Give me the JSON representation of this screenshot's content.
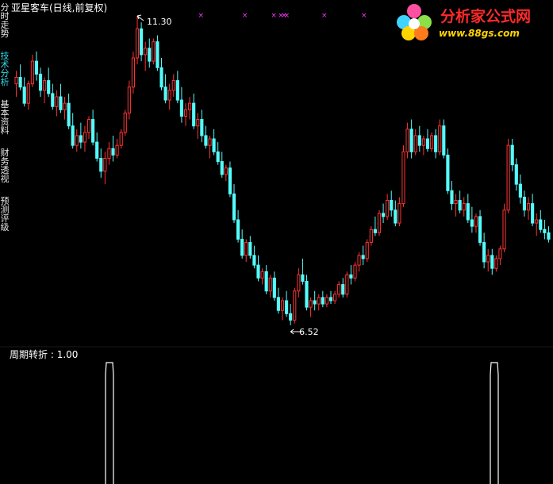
{
  "window": {
    "title": "亚星客车(日线,前复权)",
    "side_tabs": [
      {
        "label": "分时走势",
        "active": false
      },
      {
        "label": "技术分析",
        "active": true
      },
      {
        "label": "基本资料",
        "active": false
      },
      {
        "label": "财务透视",
        "active": false
      },
      {
        "label": "预测评级",
        "active": false
      }
    ]
  },
  "logo": {
    "text": "分析家公式网",
    "url": "www.88gs.com"
  },
  "colors": {
    "up": "#ff3232",
    "down": "#54fcfc",
    "marker": "#ff33ff",
    "indicator": "#ffffff",
    "text": "#ffffff",
    "active_tab": "#33d8e6"
  },
  "chart_data": [
    {
      "type": "candlestick",
      "title": "亚星客车(日线,前复权)",
      "annotations": [
        {
          "label": "11.30",
          "kind": "high"
        },
        {
          "label": "6.52",
          "kind": "low"
        }
      ],
      "ylim": [
        6.52,
        11.3
      ],
      "marker_symbol": "×",
      "marker_count": 8,
      "candles": [
        [
          10.25,
          10.45,
          10.05,
          10.35
        ],
        [
          10.35,
          10.55,
          10.15,
          10.2
        ],
        [
          10.2,
          10.35,
          9.9,
          9.95
        ],
        [
          9.95,
          10.3,
          9.85,
          10.25
        ],
        [
          10.25,
          10.7,
          10.2,
          10.6
        ],
        [
          10.6,
          10.75,
          10.3,
          10.4
        ],
        [
          10.4,
          10.5,
          10.05,
          10.15
        ],
        [
          10.15,
          10.35,
          9.95,
          10.3
        ],
        [
          10.3,
          10.5,
          10.05,
          10.1
        ],
        [
          10.1,
          10.25,
          9.85,
          9.9
        ],
        [
          9.9,
          10.15,
          9.75,
          10.05
        ],
        [
          10.05,
          10.25,
          9.8,
          9.85
        ],
        [
          9.85,
          10.05,
          9.7,
          9.95
        ],
        [
          9.95,
          10.1,
          9.55,
          9.6
        ],
        [
          9.6,
          9.8,
          9.25,
          9.3
        ],
        [
          9.3,
          9.55,
          9.2,
          9.45
        ],
        [
          9.45,
          9.65,
          9.25,
          9.35
        ],
        [
          9.35,
          9.6,
          9.2,
          9.5
        ],
        [
          9.5,
          9.75,
          9.4,
          9.7
        ],
        [
          9.7,
          9.85,
          9.3,
          9.35
        ],
        [
          9.35,
          9.5,
          9.05,
          9.1
        ],
        [
          9.1,
          9.25,
          8.8,
          8.9
        ],
        [
          8.9,
          9.2,
          8.7,
          9.1
        ],
        [
          9.1,
          9.35,
          9.0,
          9.25
        ],
        [
          9.25,
          9.45,
          9.05,
          9.15
        ],
        [
          9.15,
          9.4,
          9.1,
          9.3
        ],
        [
          9.3,
          9.55,
          9.25,
          9.5
        ],
        [
          9.5,
          9.85,
          9.45,
          9.8
        ],
        [
          9.8,
          10.3,
          9.7,
          10.2
        ],
        [
          10.2,
          10.75,
          10.1,
          10.65
        ],
        [
          10.65,
          11.3,
          10.55,
          11.1
        ],
        [
          11.1,
          11.2,
          10.6,
          10.7
        ],
        [
          10.7,
          10.9,
          10.45,
          10.8
        ],
        [
          10.8,
          10.95,
          10.5,
          10.6
        ],
        [
          10.6,
          10.95,
          10.55,
          10.9
        ],
        [
          10.9,
          11.0,
          10.45,
          10.5
        ],
        [
          10.5,
          10.65,
          10.15,
          10.2
        ],
        [
          10.2,
          10.4,
          9.95,
          10.0
        ],
        [
          10.0,
          10.25,
          9.85,
          10.15
        ],
        [
          10.15,
          10.4,
          10.05,
          10.3
        ],
        [
          10.3,
          10.45,
          9.95,
          10.0
        ],
        [
          10.0,
          10.2,
          9.65,
          9.75
        ],
        [
          9.75,
          9.95,
          9.6,
          9.85
        ],
        [
          9.85,
          10.05,
          9.7,
          9.95
        ],
        [
          9.95,
          10.1,
          9.55,
          9.6
        ],
        [
          9.6,
          9.8,
          9.4,
          9.7
        ],
        [
          9.7,
          9.85,
          9.35,
          9.45
        ],
        [
          9.45,
          9.6,
          9.25,
          9.3
        ],
        [
          9.3,
          9.45,
          9.1,
          9.4
        ],
        [
          9.4,
          9.55,
          9.15,
          9.2
        ],
        [
          9.2,
          9.35,
          9.0,
          9.05
        ],
        [
          9.05,
          9.2,
          8.8,
          8.85
        ],
        [
          8.85,
          9.0,
          8.75,
          8.95
        ],
        [
          8.95,
          9.05,
          8.5,
          8.55
        ],
        [
          8.55,
          8.7,
          8.1,
          8.15
        ],
        [
          8.15,
          8.3,
          7.8,
          7.85
        ],
        [
          7.85,
          8.0,
          7.55,
          7.6
        ],
        [
          7.6,
          7.85,
          7.5,
          7.8
        ],
        [
          7.8,
          7.9,
          7.55,
          7.6
        ],
        [
          7.6,
          7.75,
          7.4,
          7.45
        ],
        [
          7.45,
          7.6,
          7.2,
          7.25
        ],
        [
          7.25,
          7.4,
          7.15,
          7.35
        ],
        [
          7.35,
          7.45,
          7.0,
          7.05
        ],
        [
          7.05,
          7.3,
          6.95,
          7.25
        ],
        [
          7.25,
          7.35,
          6.9,
          6.95
        ],
        [
          6.95,
          7.1,
          6.7,
          6.75
        ],
        [
          6.75,
          6.95,
          6.6,
          6.9
        ],
        [
          6.9,
          7.05,
          6.65,
          6.7
        ],
        [
          6.7,
          6.85,
          6.52,
          6.6
        ],
        [
          6.6,
          7.1,
          6.55,
          7.05
        ],
        [
          7.05,
          7.4,
          6.95,
          7.3
        ],
        [
          7.3,
          7.55,
          7.15,
          7.2
        ],
        [
          7.2,
          7.3,
          6.75,
          6.8
        ],
        [
          6.8,
          6.95,
          6.65,
          6.9
        ],
        [
          6.9,
          7.05,
          6.75,
          6.85
        ],
        [
          6.85,
          7.0,
          6.75,
          6.95
        ],
        [
          6.95,
          7.05,
          6.8,
          6.85
        ],
        [
          6.85,
          7.0,
          6.8,
          6.95
        ],
        [
          6.95,
          7.05,
          6.85,
          6.9
        ],
        [
          6.9,
          7.05,
          6.85,
          7.0
        ],
        [
          7.0,
          7.2,
          6.95,
          7.15
        ],
        [
          7.15,
          7.25,
          6.95,
          7.0
        ],
        [
          7.0,
          7.35,
          6.95,
          7.3
        ],
        [
          7.3,
          7.45,
          7.15,
          7.25
        ],
        [
          7.25,
          7.5,
          7.2,
          7.45
        ],
        [
          7.45,
          7.65,
          7.35,
          7.6
        ],
        [
          7.6,
          7.75,
          7.45,
          7.55
        ],
        [
          7.55,
          7.85,
          7.5,
          7.8
        ],
        [
          7.8,
          8.05,
          7.75,
          8.0
        ],
        [
          8.0,
          8.2,
          7.9,
          7.95
        ],
        [
          7.95,
          8.3,
          7.9,
          8.25
        ],
        [
          8.25,
          8.4,
          8.1,
          8.2
        ],
        [
          8.2,
          8.55,
          8.15,
          8.45
        ],
        [
          8.45,
          8.6,
          8.2,
          8.3
        ],
        [
          8.3,
          8.45,
          8.05,
          8.1
        ],
        [
          8.1,
          8.5,
          8.05,
          8.4
        ],
        [
          8.4,
          9.3,
          8.35,
          9.2
        ],
        [
          9.2,
          9.65,
          9.1,
          9.55
        ],
        [
          9.55,
          9.7,
          9.1,
          9.2
        ],
        [
          9.2,
          9.55,
          9.15,
          9.45
        ],
        [
          9.45,
          9.6,
          9.2,
          9.3
        ],
        [
          9.3,
          9.45,
          9.15,
          9.4
        ],
        [
          9.4,
          9.55,
          9.2,
          9.25
        ],
        [
          9.25,
          9.5,
          9.2,
          9.45
        ],
        [
          9.45,
          9.55,
          9.1,
          9.2
        ],
        [
          9.2,
          9.7,
          9.15,
          9.6
        ],
        [
          9.6,
          9.7,
          9.1,
          9.15
        ],
        [
          9.15,
          9.25,
          8.55,
          8.6
        ],
        [
          8.6,
          8.75,
          8.3,
          8.4
        ],
        [
          8.4,
          8.55,
          8.2,
          8.45
        ],
        [
          8.45,
          8.6,
          8.25,
          8.3
        ],
        [
          8.3,
          8.5,
          8.2,
          8.4
        ],
        [
          8.4,
          8.55,
          8.1,
          8.15
        ],
        [
          8.15,
          8.35,
          7.95,
          8.05
        ],
        [
          8.05,
          8.25,
          7.95,
          8.2
        ],
        [
          8.2,
          8.3,
          7.75,
          7.8
        ],
        [
          7.8,
          7.95,
          7.4,
          7.5
        ],
        [
          7.5,
          7.7,
          7.35,
          7.6
        ],
        [
          7.6,
          7.7,
          7.3,
          7.4
        ],
        [
          7.4,
          7.6,
          7.35,
          7.55
        ],
        [
          7.55,
          7.75,
          7.45,
          7.7
        ],
        [
          7.7,
          8.4,
          7.65,
          8.3
        ],
        [
          8.3,
          9.4,
          8.25,
          9.3
        ],
        [
          9.3,
          9.4,
          8.9,
          9.0
        ],
        [
          9.0,
          9.1,
          8.6,
          8.7
        ],
        [
          8.7,
          8.85,
          8.4,
          8.5
        ],
        [
          8.5,
          8.6,
          8.2,
          8.3
        ],
        [
          8.3,
          8.5,
          8.15,
          8.4
        ],
        [
          8.4,
          8.55,
          8.05,
          8.1
        ],
        [
          8.1,
          8.25,
          7.9,
          8.15
        ],
        [
          8.15,
          8.3,
          7.95,
          8.0
        ],
        [
          8.0,
          8.15,
          7.85,
          7.95
        ],
        [
          7.95,
          8.05,
          7.8,
          7.85
        ]
      ]
    },
    {
      "type": "line",
      "title": "周期转折",
      "series": [
        {
          "name": "周期转折",
          "value_label": "1.00"
        }
      ],
      "segments": [
        {
          "y": [
            0.0,
            0.9,
            1.0,
            1.0,
            0.9,
            0.0
          ]
        },
        {
          "y": [
            0.0,
            0.9,
            1.0,
            1.0,
            0.9,
            0.0
          ]
        }
      ]
    }
  ]
}
